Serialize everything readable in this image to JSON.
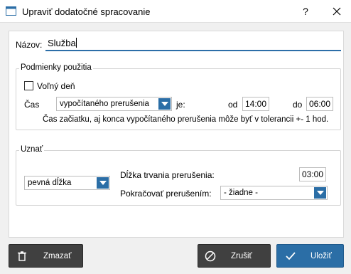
{
  "window": {
    "title": "Upraviť dodatočné spracovanie",
    "help_label": "?",
    "close_icon": "close-icon"
  },
  "name": {
    "label": "Názov:",
    "value": "Služba"
  },
  "conditions": {
    "title": "Podmienky použitia",
    "free_day_label": "Voľný deň",
    "free_day_checked": false,
    "time_label": "Čas",
    "time_type_value": "vypočítaného prerušenia",
    "is_label": "je:",
    "from_label": "od",
    "from_value": "14:00",
    "to_label": "do",
    "to_value": "06:00",
    "note": "Čas začiatku, aj konca vypočítaného prerušenia môže byť v tolerancii +- 1 hod."
  },
  "recognize": {
    "title": "Uznať",
    "mode_value": "pevná dĺžka",
    "duration_label": "Dĺžka trvania prerušenia:",
    "duration_value": "03:00",
    "continue_label": "Pokračovať prerušením:",
    "continue_value": "- žiadne -"
  },
  "buttons": {
    "delete_label": "Zmazať",
    "cancel_label": "Zrušiť",
    "save_label": "Uložiť"
  },
  "colors": {
    "accent": "#2b6ea6",
    "dark_button": "#404040"
  }
}
